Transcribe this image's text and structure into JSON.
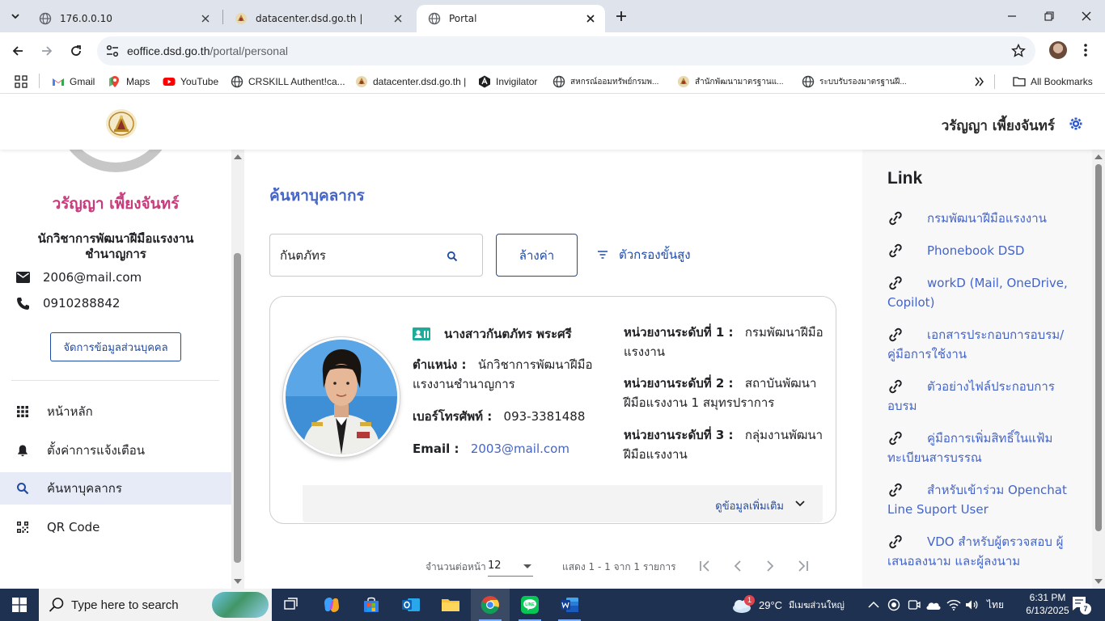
{
  "browser": {
    "tabs": [
      {
        "title": "176.0.0.10"
      },
      {
        "title": "datacenter.dsd.go.th |"
      },
      {
        "title": "Portal",
        "active": true
      }
    ],
    "url": {
      "host": "eoffice.dsd.go.th",
      "path": "/portal/personal"
    },
    "bookmarks": [
      {
        "label": "Gmail",
        "icon": "gmail-icon"
      },
      {
        "label": "Maps",
        "icon": "maps-icon"
      },
      {
        "label": "YouTube",
        "icon": "youtube-icon"
      },
      {
        "label": "CRSKILL Authent!ca...",
        "icon": "globe-icon"
      },
      {
        "label": "datacenter.dsd.go.th |",
        "icon": "dsd-icon"
      },
      {
        "label": "Invigilator",
        "icon": "invigilator-icon"
      },
      {
        "label": "สหกรณ์ออมทรัพย์กรมพ...",
        "icon": "globe-icon"
      },
      {
        "label": "สำนักพัฒนามาตรฐานแ...",
        "icon": "dsd-icon"
      },
      {
        "label": "ระบบรับรองมาตรฐานฝี...",
        "icon": "globe-icon"
      }
    ],
    "all_bookmarks_label": "All Bookmarks"
  },
  "header": {
    "user_name": "วรัญญา เพี้ยงจันทร์"
  },
  "sidebar": {
    "name": "วรัญญา เพี้ยงจันทร์",
    "position": "นักวิชาการพัฒนาฝีมือแรงงาน ชำนาญการ",
    "email": "2006@mail.com",
    "phone": "0910288842",
    "manage_button": "จัดการข้อมูลส่วนบุคคล",
    "menu": [
      {
        "label": "หน้าหลัก",
        "icon": "grid-icon"
      },
      {
        "label": "ตั้งค่าการแจ้งเตือน",
        "icon": "bell-icon"
      },
      {
        "label": "ค้นหาบุคลากร",
        "icon": "search-icon",
        "active": true
      },
      {
        "label": "QR Code",
        "icon": "qr-code-icon"
      }
    ]
  },
  "main": {
    "title": "ค้นหาบุคลากร",
    "search_value": "กันตภัทร",
    "clear_button": "ล้างค่า",
    "advanced_filter": "ตัวกรองขั้นสูง",
    "result": {
      "name": "นางสาวกันตภัทร พระศรี",
      "position_label": "ตำแหน่ง :",
      "position_value": "นักวิชาการพัฒนาฝีมือแรงงานชำนาญการ",
      "phone_label": "เบอร์โทรศัพท์ :",
      "phone_value": "093-3381488",
      "email_label": "Email :",
      "email_value": "2003@mail.com",
      "unit1_label": "หน่วยงานระดับที่ 1 :",
      "unit1_value": "กรมพัฒนาฝีมือแรงงาน",
      "unit2_label": "หน่วยงานระดับที่ 2 :",
      "unit2_value": "สถาบันพัฒนาฝีมือแรงงาน 1 สมุทรปราการ",
      "unit3_label": "หน่วยงานระดับที่ 3 :",
      "unit3_value": "กลุ่มงานพัฒนาฝีมือแรงงาน",
      "more_label": "ดูข้อมูลเพิ่มเติม"
    },
    "pagination": {
      "per_page_label": "จำนวนต่อหน้า",
      "per_page_value": "12",
      "range_label": "แสดง 1 - 1 จาก 1 รายการ"
    }
  },
  "links": {
    "title": "Link",
    "items": [
      "กรมพัฒนาฝีมือแรงงาน",
      "Phonebook DSD",
      "workD (Mail, OneDrive, Copilot)",
      "เอกสารประกอบการอบรม/คู่มือการใช้งาน",
      "ตัวอย่างไฟล์ประกอบการอบรม",
      "คู่มือการเพิ่มสิทธิ์ในแฟ้มทะเบียนสารบรรณ",
      "สำหรับเข้าร่วม Openchat Line Suport User",
      "VDO สำหรับผู้ตรวจสอบ ผู้เสนอลงนาม และผู้ลงนาม"
    ]
  },
  "taskbar": {
    "search_placeholder": "Type here to search",
    "weather_temp": "29°C",
    "weather_text": "มีเมฆส่วนใหญ่",
    "weather_badge": "1",
    "language": "ไทย",
    "time": "6:31 PM",
    "date": "6/13/2025",
    "notification_count": "7"
  },
  "colors": {
    "accent_blue": "#4464c8",
    "button_blue": "#1e4aa6",
    "profile_name_pink": "#c93a7c",
    "active_menu_bg": "#e6ebf7",
    "taskbar": "#1f3150"
  }
}
